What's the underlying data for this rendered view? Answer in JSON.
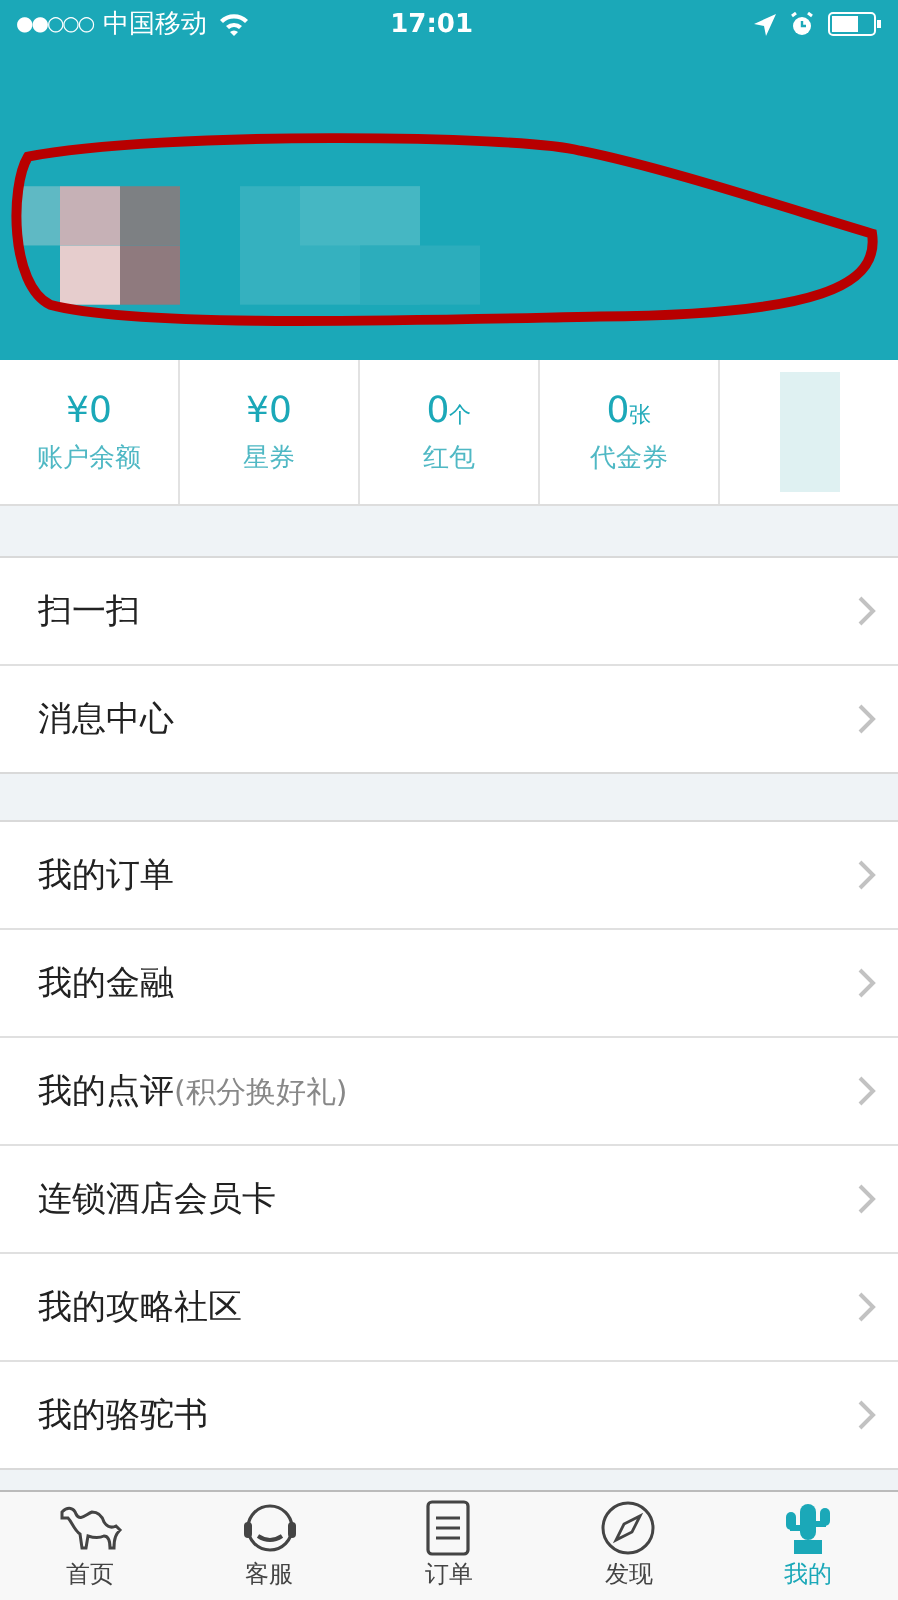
{
  "status_bar": {
    "signal": "●●○○○",
    "carrier": "中国移动",
    "time": "17:01"
  },
  "stats": [
    {
      "value": "¥0",
      "label": "账户余额"
    },
    {
      "value": "¥0",
      "label": "星券"
    },
    {
      "value": "0",
      "unit": "个",
      "label": "红包"
    },
    {
      "value": "0",
      "unit": "张",
      "label": "代金券"
    }
  ],
  "menu_groups": [
    [
      {
        "label": "扫一扫"
      },
      {
        "label": "消息中心"
      }
    ],
    [
      {
        "label": "我的订单"
      },
      {
        "label": "我的金融"
      },
      {
        "label": "我的点评",
        "note": "(积分换好礼)"
      },
      {
        "label": "连锁酒店会员卡"
      },
      {
        "label": "我的攻略社区"
      },
      {
        "label": "我的骆驼书"
      }
    ]
  ],
  "tab_bar": [
    {
      "label": "首页",
      "selected": false
    },
    {
      "label": "客服",
      "selected": false
    },
    {
      "label": "订单",
      "selected": false
    },
    {
      "label": "发现",
      "selected": false
    },
    {
      "label": "我的",
      "selected": true
    }
  ]
}
